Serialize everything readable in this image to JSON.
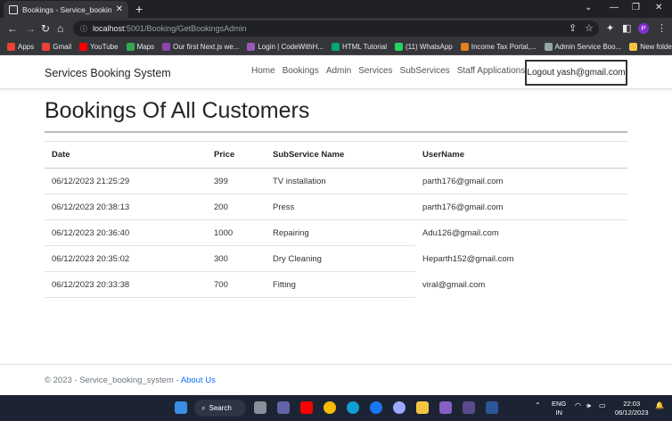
{
  "browser": {
    "tab_title": "Bookings - Service_booking_sy...",
    "url_host": "localhost",
    "url_path": ":5001/Booking/GetBookingsAdmin",
    "profile_initial": "P",
    "bookmarks": [
      {
        "label": "Apps",
        "color": "#ea4335"
      },
      {
        "label": "Gmail",
        "color": "#ea4335"
      },
      {
        "label": "YouTube",
        "color": "#ff0000"
      },
      {
        "label": "Maps",
        "color": "#34a853"
      },
      {
        "label": "Our first Next.js we...",
        "color": "#8e44ad"
      },
      {
        "label": "Login | CodeWithH...",
        "color": "#9b59b6"
      },
      {
        "label": "HTML Tutorial",
        "color": "#04aa6d"
      },
      {
        "label": "(11) WhatsApp",
        "color": "#25d366"
      },
      {
        "label": "Income Tax Portal,...",
        "color": "#e67e22"
      },
      {
        "label": "Admin Service Boo...",
        "color": "#95a5a6"
      },
      {
        "label": "New folder",
        "color": "#f4c542"
      }
    ]
  },
  "site": {
    "brand": "Services Booking System",
    "nav": [
      "Home",
      "Bookings",
      "Admin",
      "Services",
      "SubServices",
      "Staff Applications"
    ],
    "logout_label": "Logout yash@gmail.com"
  },
  "page": {
    "title": "Bookings Of All Customers",
    "columns": [
      "Date",
      "Price",
      "SubService Name",
      "UserName"
    ],
    "rows": [
      [
        "06/12/2023 21:25:29",
        "399",
        "TV installation",
        "parth176@gmail.com"
      ],
      [
        "06/12/2023 20:38:13",
        "200",
        "Press",
        "parth176@gmail.com"
      ],
      [
        "06/12/2023 20:36:40",
        "1000",
        "Repairing",
        "Adu126@gmail.com"
      ],
      [
        "06/12/2023 20:35:02",
        "300",
        "Dry Cleaning",
        "Heparth152@gmail.com"
      ],
      [
        "06/12/2023 20:33:38",
        "700",
        "Fitting",
        "viral@gmail.com"
      ]
    ]
  },
  "footer": {
    "text": "© 2023 - Service_booking_system - ",
    "link": "About Us"
  },
  "taskbar": {
    "search_label": "Search",
    "lang_line1": "ENG",
    "lang_line2": "IN",
    "time": "22:03",
    "date": "06/12/2023"
  }
}
